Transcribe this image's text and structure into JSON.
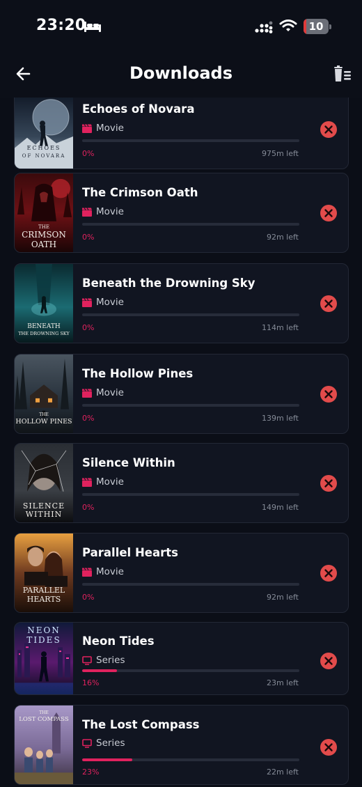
{
  "status_bar": {
    "time": "23:20",
    "battery_level": "10",
    "battery_color": "#e03a3a",
    "icons": [
      "bed-icon",
      "signal-icon",
      "wifi-icon",
      "battery-icon"
    ]
  },
  "header": {
    "title": "Downloads",
    "back_icon": "arrow-left-icon",
    "delete_all_icon": "trash-list-icon"
  },
  "colors": {
    "accent": "#e0225e",
    "cancel": "#e24b4b",
    "card_bg": "#111521"
  },
  "downloads": [
    {
      "title": "Echoes of Novara",
      "type": "Movie",
      "type_icon": "clapperboard-icon",
      "progress_label": "0%",
      "progress": 0,
      "remaining": "975m left",
      "poster_text": [
        "ECHOES",
        "OF NOVARA"
      ]
    },
    {
      "title": "The Crimson Oath",
      "type": "Movie",
      "type_icon": "clapperboard-icon",
      "progress_label": "0%",
      "progress": 0,
      "remaining": "92m left",
      "poster_text": [
        "THE",
        "CRIMSON",
        "OATH"
      ]
    },
    {
      "title": "Beneath the Drowning Sky",
      "type": "Movie",
      "type_icon": "clapperboard-icon",
      "progress_label": "0%",
      "progress": 0,
      "remaining": "114m left",
      "poster_text": [
        "BENEATH",
        "THE DROWNING SKY"
      ]
    },
    {
      "title": "The Hollow Pines",
      "type": "Movie",
      "type_icon": "clapperboard-icon",
      "progress_label": "0%",
      "progress": 0,
      "remaining": "139m left",
      "poster_text": [
        "THE",
        "HOLLOW PINES"
      ]
    },
    {
      "title": "Silence Within",
      "type": "Movie",
      "type_icon": "clapperboard-icon",
      "progress_label": "0%",
      "progress": 0,
      "remaining": "149m left",
      "poster_text": [
        "SILENCE",
        "WITHIN"
      ]
    },
    {
      "title": "Parallel Hearts",
      "type": "Movie",
      "type_icon": "clapperboard-icon",
      "progress_label": "0%",
      "progress": 0,
      "remaining": "92m left",
      "poster_text": [
        "PARALLEL",
        "HEARTS"
      ]
    },
    {
      "title": "Neon Tides",
      "type": "Series",
      "type_icon": "tv-icon",
      "progress_label": "16%",
      "progress": 16,
      "remaining": "23m left",
      "poster_text": [
        "NEON",
        "TIDES"
      ]
    },
    {
      "title": "The Lost Compass",
      "type": "Series",
      "type_icon": "tv-icon",
      "progress_label": "23%",
      "progress": 23,
      "remaining": "22m left",
      "poster_text": [
        "THE",
        "LOST COMPASS"
      ]
    }
  ]
}
